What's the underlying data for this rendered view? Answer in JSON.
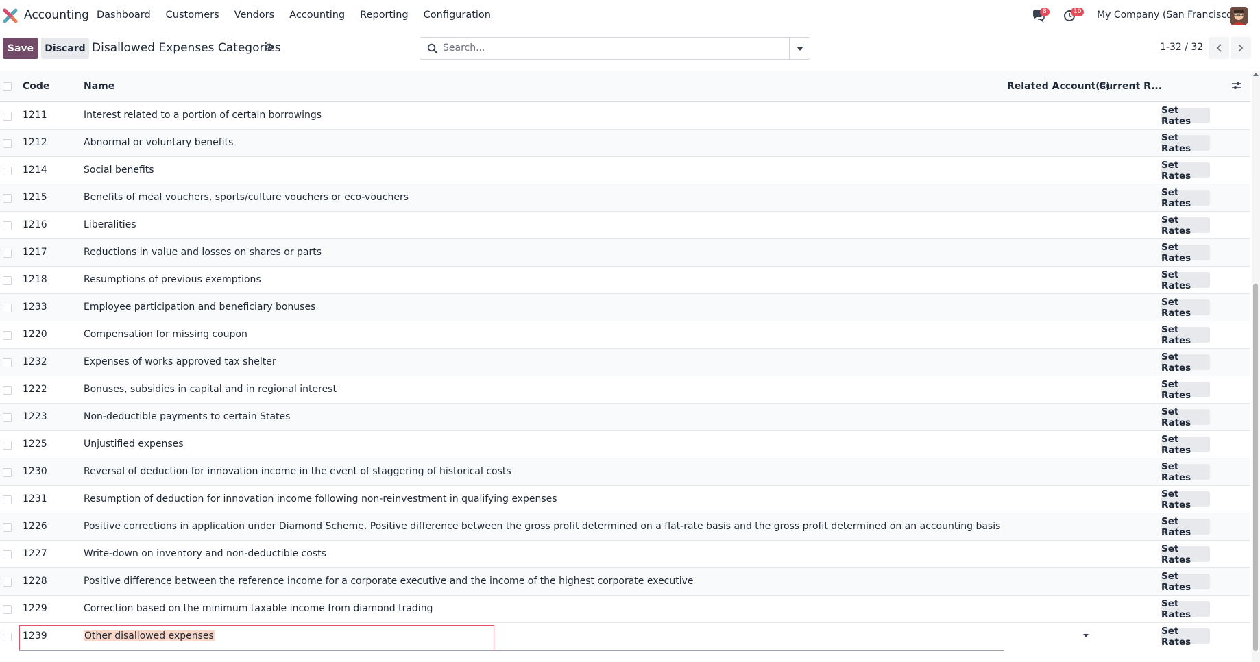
{
  "navbar": {
    "app_name": "Accounting",
    "menu": [
      "Dashboard",
      "Customers",
      "Vendors",
      "Accounting",
      "Reporting",
      "Configuration"
    ],
    "messages_badge": "8",
    "activities_badge": "10",
    "company": "My Company (San Francisco)"
  },
  "control": {
    "save_label": "Save",
    "discard_label": "Discard",
    "title": "Disallowed Expenses Categories",
    "search_placeholder": "Search...",
    "pager": "1-32 / 32"
  },
  "table": {
    "headers": {
      "code": "Code",
      "name": "Name",
      "related_accounts": "Related Account(s)",
      "current_rate": "Current R..."
    },
    "action_label": "Set Rates",
    "rows": [
      {
        "code": "1211",
        "name": "Interest related to a portion of certain borrowings"
      },
      {
        "code": "1212",
        "name": "Abnormal or voluntary benefits"
      },
      {
        "code": "1214",
        "name": "Social benefits"
      },
      {
        "code": "1215",
        "name": "Benefits of meal vouchers, sports/culture vouchers or eco-vouchers"
      },
      {
        "code": "1216",
        "name": "Liberalities"
      },
      {
        "code": "1217",
        "name": "Reductions in value and losses on shares or parts"
      },
      {
        "code": "1218",
        "name": "Resumptions of previous exemptions"
      },
      {
        "code": "1233",
        "name": "Employee participation and beneficiary bonuses"
      },
      {
        "code": "1220",
        "name": "Compensation for missing coupon"
      },
      {
        "code": "1232",
        "name": "Expenses of works approved tax shelter"
      },
      {
        "code": "1222",
        "name": "Bonuses, subsidies in capital and in regional interest"
      },
      {
        "code": "1223",
        "name": "Non-deductible payments to certain States"
      },
      {
        "code": "1225",
        "name": "Unjustified expenses"
      },
      {
        "code": "1230",
        "name": "Reversal of deduction for innovation income in the event of staggering of historical costs"
      },
      {
        "code": "1231",
        "name": "Resumption of deduction for innovation income following non-reinvestment in qualifying expenses"
      },
      {
        "code": "1226",
        "name": "Positive corrections in application under Diamond Scheme. Positive difference between the gross profit determined on a flat-rate basis and the gross profit determined on an accounting basis"
      },
      {
        "code": "1227",
        "name": "Write-down on inventory and non-deductible costs"
      },
      {
        "code": "1228",
        "name": "Positive difference between the reference income for a corporate executive and the income of the highest corporate executive"
      },
      {
        "code": "1229",
        "name": "Correction based on the minimum taxable income from diamond trading"
      }
    ],
    "editing_row": {
      "code": "1239",
      "name": "Other disallowed expenses"
    }
  },
  "colors": {
    "primary": "#714b67",
    "badge": "#e54d5a",
    "edit_border": "#e05060",
    "selection": "#f8d7c8"
  }
}
